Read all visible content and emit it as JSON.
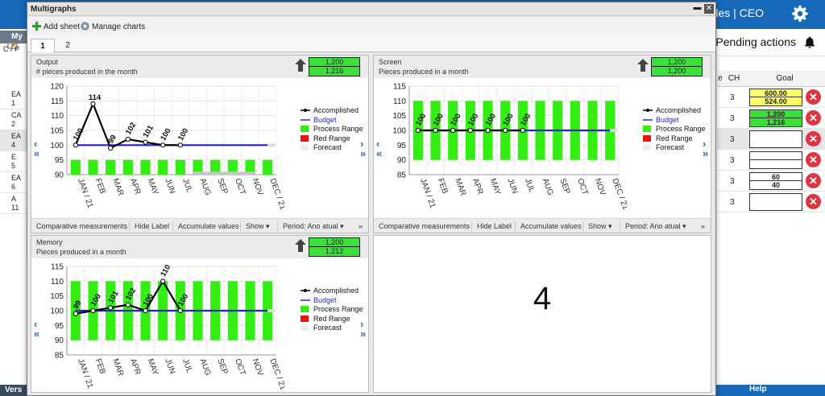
{
  "app": {
    "user_info": "e Ingles  |  CEO",
    "pending_actions": "Pending actions",
    "left_tab": "My",
    "left_col_header": "C / P",
    "left_rows": [
      {
        "a": "EA",
        "b": "1"
      },
      {
        "a": "CA",
        "b": "2"
      },
      {
        "a": "EA",
        "b": "4"
      },
      {
        "a": "E",
        "b": "5"
      },
      {
        "a": "EA",
        "b": "6"
      },
      {
        "a": "A",
        "b": "11"
      }
    ],
    "table_headers": [
      "e",
      "CH",
      "Goal"
    ],
    "table_rows": [
      {
        "ch": "3",
        "goal": [
          "600.00",
          "524.00"
        ],
        "style": "yellow"
      },
      {
        "ch": "3",
        "goal": [
          "1,200",
          "1,216"
        ],
        "style": "green"
      },
      {
        "ch": "3",
        "goal": [],
        "style": "empty"
      },
      {
        "ch": "3",
        "goal": [
          "",
          ""
        ],
        "style": "split"
      },
      {
        "ch": "3",
        "goal": [
          "60",
          "40"
        ],
        "style": "white"
      },
      {
        "ch": "3",
        "goal": [],
        "style": "empty"
      }
    ],
    "status_left": "Vers",
    "help": "Help"
  },
  "dialog": {
    "title": "Multigraphs",
    "add_sheet": "Add sheet",
    "manage_charts": "Manage charts",
    "tabs": [
      "1",
      "2"
    ],
    "empty_slot_number": "4",
    "footer": {
      "comparative": "Comparative measurements",
      "hide_label": "Hide Label",
      "accumulate": "Accumulate values",
      "show": "Show ▾",
      "period": "Period: Ano atual ▾",
      "more": "»"
    },
    "legend_labels": [
      "Accomplished",
      "Budget",
      "Process Range",
      "Red Range",
      "Forecast"
    ],
    "colors": {
      "accomplished": "#000000",
      "budget": "#2222cc",
      "process_range": "#33ee11",
      "red_range": "#ee1111",
      "forecast": "#eeeeee",
      "summary_box": "#3be13b"
    }
  },
  "chart_data": [
    {
      "type": "line",
      "title": "Output",
      "subtitle": "# pieces produced in the month",
      "summary": [
        "1,200",
        "1,216"
      ],
      "categories": [
        "JAN / 21",
        "FEB",
        "MAR",
        "APR",
        "MAY",
        "JUN",
        "JUL",
        "AUG",
        "SEP",
        "OCT",
        "NOV",
        "DEC / 21"
      ],
      "yticks": [
        "120",
        "115",
        "110",
        "105",
        "100",
        "95",
        "90"
      ],
      "ylim": [
        90,
        120
      ],
      "series": [
        {
          "name": "Accomplished",
          "values": [
            100,
            114,
            99,
            102,
            101,
            100,
            100,
            null,
            null,
            null,
            null,
            null
          ],
          "labels": [
            "100",
            "114",
            "99",
            "102",
            "101",
            "100",
            "100"
          ]
        },
        {
          "name": "Budget",
          "values": [
            100,
            100,
            100,
            100,
            100,
            100,
            100,
            100,
            100,
            100,
            100,
            100
          ]
        }
      ],
      "process_range": [
        90,
        95
      ],
      "forecast_range": [
        90,
        91
      ],
      "forecast_from": 7
    },
    {
      "type": "line",
      "title": "Screen",
      "subtitle": "Pieces produced in a month",
      "summary": [
        "1,200",
        "1,200"
      ],
      "categories": [
        "JAN / 21",
        "FEB",
        "MAR",
        "APR",
        "MAY",
        "JUN",
        "JUL",
        "AUG",
        "SEP",
        "OCT",
        "NOV",
        "DEC / 21"
      ],
      "yticks": [
        "115",
        "110",
        "105",
        "100",
        "95",
        "90",
        "85"
      ],
      "ylim": [
        85,
        115
      ],
      "series": [
        {
          "name": "Accomplished",
          "values": [
            100,
            100,
            100,
            100,
            100,
            100,
            100,
            null,
            null,
            null,
            null,
            null
          ],
          "labels": [
            "100",
            "100",
            "100",
            "100",
            "100",
            "100",
            "100"
          ]
        },
        {
          "name": "Budget",
          "values": [
            100,
            100,
            100,
            100,
            100,
            100,
            100,
            100,
            100,
            100,
            100,
            100
          ]
        }
      ],
      "process_range": [
        90,
        110
      ]
    },
    {
      "type": "line",
      "title": "Memory",
      "subtitle": "Pieces produced in a month",
      "summary": [
        "1,200",
        "1,212"
      ],
      "categories": [
        "JAN / 21",
        "FEB",
        "MAR",
        "APR",
        "MAY",
        "JUN",
        "JUL",
        "AUG",
        "SEP",
        "OCT",
        "NOV",
        "DEC / 21"
      ],
      "yticks": [
        "115",
        "110",
        "105",
        "100",
        "95",
        "90",
        "85"
      ],
      "ylim": [
        85,
        115
      ],
      "series": [
        {
          "name": "Accomplished",
          "values": [
            99,
            100,
            101,
            102,
            100,
            110,
            100,
            null,
            null,
            null,
            null,
            null
          ],
          "labels": [
            "99",
            "100",
            "101",
            "102",
            "100",
            "110",
            "100"
          ]
        },
        {
          "name": "Budget",
          "values": [
            100,
            100,
            100,
            100,
            100,
            100,
            100,
            100,
            100,
            100,
            100,
            100
          ]
        }
      ],
      "process_range": [
        90,
        110
      ]
    }
  ]
}
